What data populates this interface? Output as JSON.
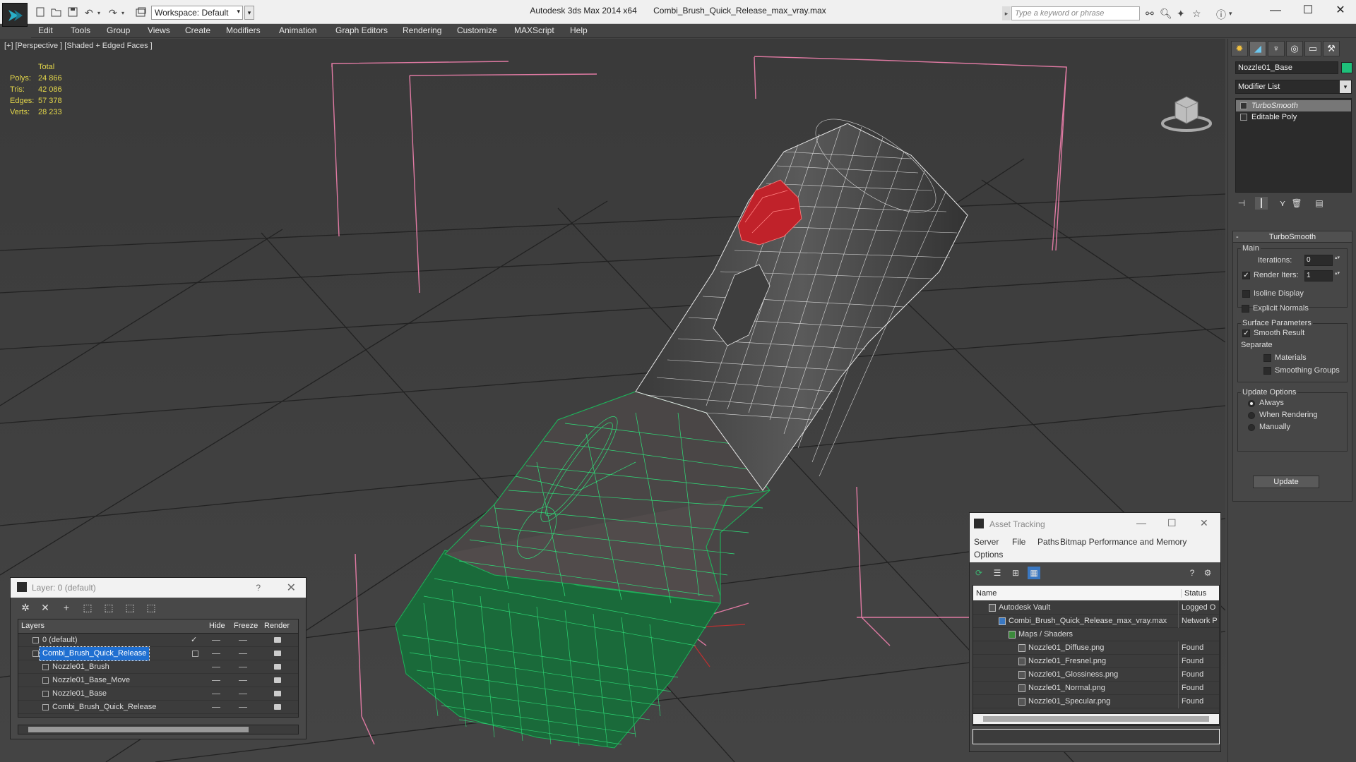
{
  "title_bar": {
    "app_name": "Autodesk 3ds Max  2014 x64",
    "file_name": "Combi_Brush_Quick_Release_max_vray.max",
    "workspace_label": "Workspace: Default",
    "search_placeholder": "Type a keyword or phrase"
  },
  "menu": {
    "items": [
      "Edit",
      "Tools",
      "Group",
      "Views",
      "Create",
      "Modifiers",
      "Animation",
      "Graph Editors",
      "Rendering",
      "Customize",
      "MAXScript",
      "Help"
    ]
  },
  "viewport": {
    "label": "[+] [Perspective ] [Shaded + Edged Faces ]",
    "stats": {
      "header": "Total",
      "rows": [
        {
          "label": "Polys:",
          "value": "24 866"
        },
        {
          "label": "Tris:",
          "value": "42 086"
        },
        {
          "label": "Edges:",
          "value": "57 378"
        },
        {
          "label": "Verts:",
          "value": "28 233"
        }
      ]
    }
  },
  "command_panel": {
    "object_name": "Nozzle01_Base",
    "object_color": "#1ec07a",
    "modifier_list": "Modifier List",
    "stack": [
      {
        "label": "TurboSmooth",
        "selected": true
      },
      {
        "label": "Editable Poly",
        "selected": false
      }
    ],
    "turbosmooth": {
      "title": "TurboSmooth",
      "main_label": "Main",
      "iterations_label": "Iterations:",
      "iterations_value": "0",
      "render_iters_label": "Render Iters:",
      "render_iters_value": "1",
      "isoline_label": "Isoline Display",
      "explicit_normals_label": "Explicit Normals",
      "surface_label": "Surface Parameters",
      "smooth_result_label": "Smooth Result",
      "separate_label": "Separate",
      "materials_label": "Materials",
      "smoothing_groups_label": "Smoothing Groups",
      "update_options_label": "Update Options",
      "always_label": "Always",
      "when_rendering_label": "When Rendering",
      "manually_label": "Manually",
      "update_button": "Update"
    }
  },
  "layer_window": {
    "title": "Layer: 0 (default)",
    "help": "?",
    "columns": {
      "layers": "Layers",
      "hide": "Hide",
      "freeze": "Freeze",
      "render": "Render"
    },
    "rows": [
      {
        "name": "0 (default)",
        "indent": 1,
        "selected": false,
        "checked": true
      },
      {
        "name": "Combi_Brush_Quick_Release",
        "indent": 1,
        "selected": true,
        "checked": false
      },
      {
        "name": "Nozzle01_Brush",
        "indent": 2,
        "selected": false,
        "checked": false
      },
      {
        "name": "Nozzle01_Base_Move",
        "indent": 2,
        "selected": false,
        "checked": false
      },
      {
        "name": "Nozzle01_Base",
        "indent": 2,
        "selected": false,
        "checked": false
      },
      {
        "name": "Combi_Brush_Quick_Release",
        "indent": 2,
        "selected": false,
        "checked": false
      }
    ]
  },
  "asset_tracking": {
    "title": "Asset Tracking",
    "menu": [
      "Server",
      "File",
      "Paths",
      "Bitmap Performance and Memory",
      "Options"
    ],
    "columns": {
      "name": "Name",
      "status": "Status"
    },
    "rows": [
      {
        "name": "Autodesk Vault",
        "status": "Logged O",
        "indent": 1
      },
      {
        "name": "Combi_Brush_Quick_Release_max_vray.max",
        "status": "Network P",
        "indent": 2
      },
      {
        "name": "Maps / Shaders",
        "status": "",
        "indent": 3
      },
      {
        "name": "Nozzle01_Diffuse.png",
        "status": "Found",
        "indent": 4
      },
      {
        "name": "Nozzle01_Fresnel.png",
        "status": "Found",
        "indent": 4
      },
      {
        "name": "Nozzle01_Glossiness.png",
        "status": "Found",
        "indent": 4
      },
      {
        "name": "Nozzle01_Normal.png",
        "status": "Found",
        "indent": 4
      },
      {
        "name": "Nozzle01_Specular.png",
        "status": "Found",
        "indent": 4
      }
    ]
  },
  "colors": {
    "stats_text": "#e5d84a",
    "wire_green": "#1db35a",
    "wire_white": "#e8e8e8",
    "button_red": "#c0222a",
    "bbox_pink": "#e07aa3",
    "selection_blue": "#1f6fd1"
  }
}
